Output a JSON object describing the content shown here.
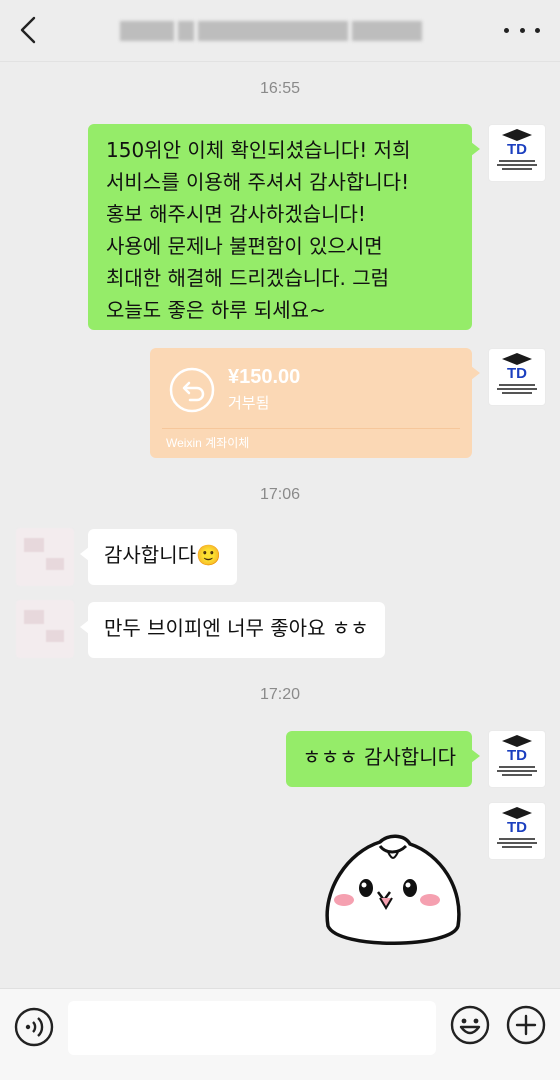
{
  "header": {
    "title_blurred": true,
    "back_icon": "chevron-left-icon",
    "more_icon": "ellipsis-icon"
  },
  "messages": [
    {
      "type": "timestamp",
      "text": "16:55"
    },
    {
      "type": "text",
      "side": "right",
      "text": "150위안 이체 확인되셨습니다! 저희\n서비스를 이용해 주셔서 감사합니다!\n홍보 해주시면 감사하겠습니다!\n사용에 문제나 불편함이 있으시면\n최대한 해결해 드리겠습니다. 그럼\n오늘도 좋은 하루 되세요~"
    },
    {
      "type": "transfer",
      "side": "right",
      "amount": "¥150.00",
      "status": "거부됨",
      "label": "Weixin 계좌이체",
      "icon": "return-arrow-icon"
    },
    {
      "type": "timestamp",
      "text": "17:06"
    },
    {
      "type": "text",
      "side": "left",
      "text": "감사합니다",
      "emoji": "🙂"
    },
    {
      "type": "text",
      "side": "left",
      "text": "만두 브이피엔 너무 좋아요 ㅎㅎ"
    },
    {
      "type": "timestamp",
      "text": "17:20"
    },
    {
      "type": "text",
      "side": "right",
      "text": "ㅎㅎㅎ 감사합니다"
    },
    {
      "type": "sticker",
      "side": "right",
      "description": "dumpling-sticker"
    }
  ],
  "avatar_self_text": "TD",
  "input": {
    "placeholder": "",
    "value": ""
  },
  "bottom_icons": [
    "voice-icon",
    "emoji-icon",
    "plus-icon"
  ],
  "colors": {
    "background": "#ededed",
    "self_bubble": "#95ec69",
    "other_bubble": "#ffffff",
    "transfer_card": "#fbd8b5",
    "timestamp": "#8a8a8a"
  }
}
